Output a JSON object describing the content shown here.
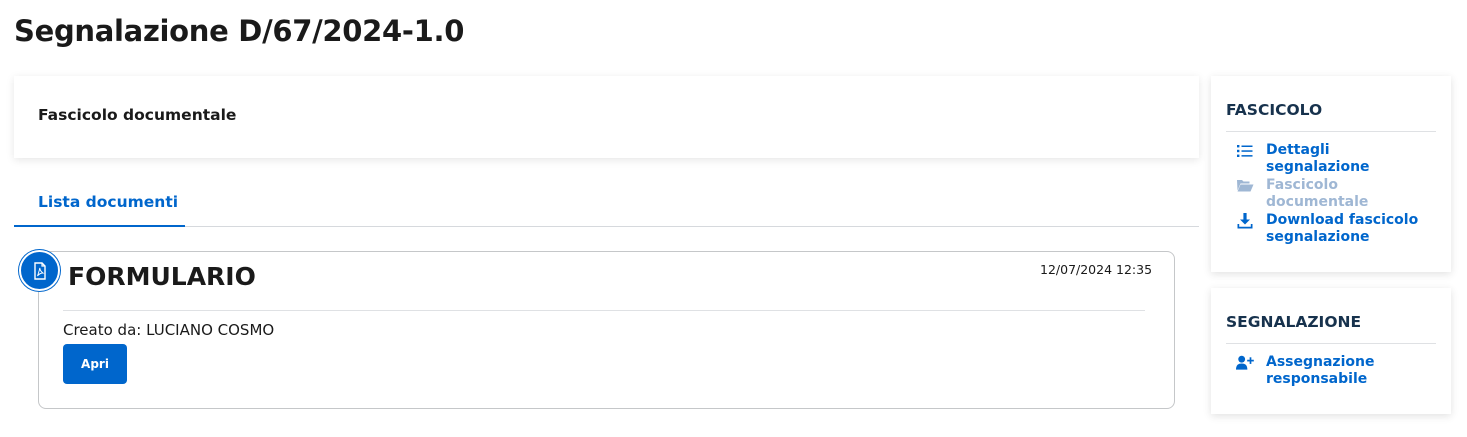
{
  "page": {
    "title": "Segnalazione D/67/2024-1.0"
  },
  "main": {
    "section_title": "Fascicolo documentale",
    "tabs": [
      {
        "label": "Lista documenti",
        "active": true
      }
    ],
    "document": {
      "icon": "pdf-file-icon",
      "title": "FORMULARIO",
      "date": "12/07/2024 12:35",
      "creator_label": "Creato da:",
      "creator_name": "LUCIANO COSMO",
      "open_label": "Apri"
    }
  },
  "sidebar": {
    "fascicolo": {
      "heading": "FASCICOLO",
      "items": [
        {
          "label": "Dettagli segnalazione",
          "icon": "list-icon",
          "disabled": false
        },
        {
          "label": "Fascicolo documentale",
          "icon": "folder-open-icon",
          "disabled": true
        },
        {
          "label": "Download fascicolo segnalazione",
          "icon": "download-icon",
          "disabled": false
        }
      ]
    },
    "segnalazione": {
      "heading": "SEGNALAZIONE",
      "items": [
        {
          "label": "Assegnazione responsabile",
          "icon": "user-plus-icon",
          "disabled": false
        }
      ]
    }
  },
  "colors": {
    "primary": "#0066cc",
    "disabled": "#9fb7d4",
    "heading": "#17324d"
  }
}
